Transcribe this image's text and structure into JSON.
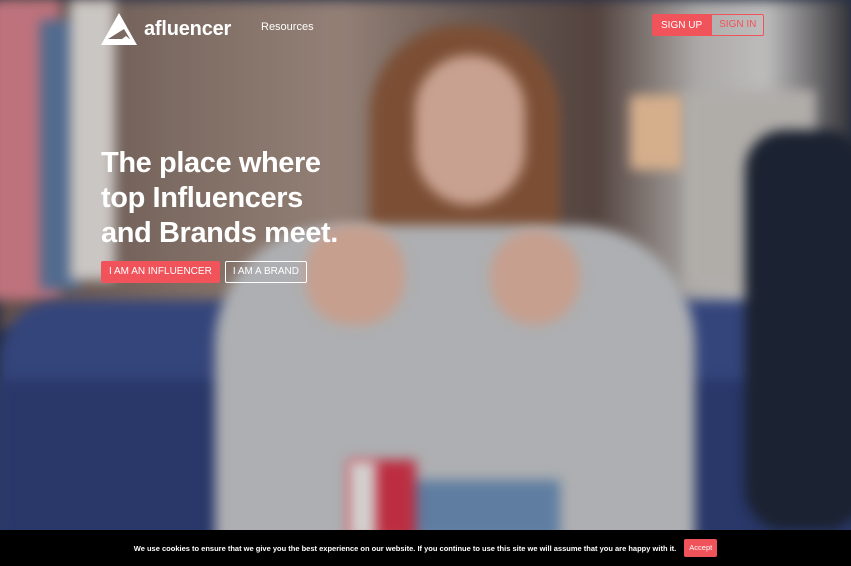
{
  "brand": {
    "name": "afluencer",
    "logo_icon": "afluencer-logo-icon"
  },
  "nav": {
    "resources_label": "Resources"
  },
  "auth": {
    "signup_label": "SIGN UP",
    "signin_label": "SIGN IN"
  },
  "hero": {
    "title_line1": "The place where",
    "title_line2": "top Influencers",
    "title_line3": "and Brands meet.",
    "influencer_button": "I AM AN INFLUENCER",
    "brand_button": "I AM A BRAND"
  },
  "cookie": {
    "message": "We use cookies to ensure that we give you the best experience on our website. If you continue to use this site we will assume that you are happy with it.",
    "accept_label": "Accept"
  },
  "colors": {
    "accent": "#f1535a",
    "cookie_bg": "#000000",
    "text": "#ffffff"
  }
}
